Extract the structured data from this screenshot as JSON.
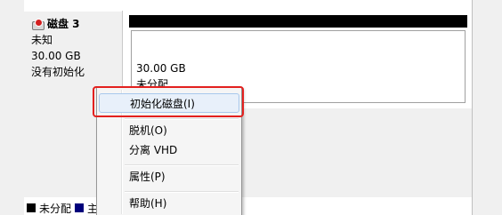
{
  "disk": {
    "title": "磁盘 3",
    "type": "未知",
    "size": "30.00 GB",
    "status": "没有初始化",
    "icon": "disk-warning-icon"
  },
  "partition": {
    "size": "30.00 GB",
    "status": "未分配",
    "bar_color": "#000000"
  },
  "context_menu": {
    "items": [
      {
        "label": "初始化磁盘(I)"
      },
      {
        "label": "脱机(O)"
      },
      {
        "label": "分离 VHD"
      },
      {
        "label": "属性(P)"
      },
      {
        "label": "帮助(H)"
      }
    ],
    "highlight_color": "#e3201e"
  },
  "legend": {
    "items": [
      {
        "label": "未分配",
        "color": "#000000"
      },
      {
        "label": "主",
        "color": "#00007b"
      }
    ]
  }
}
